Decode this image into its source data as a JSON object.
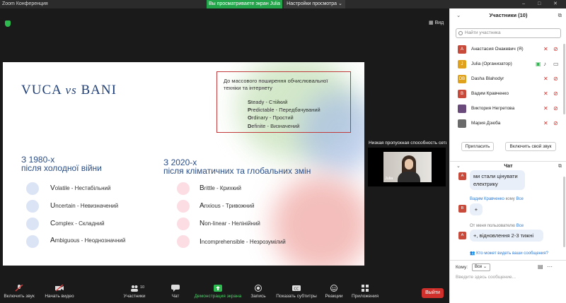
{
  "window": {
    "title": "Zoom Конференция",
    "controls": "–  □  ✕"
  },
  "share_banner": "Вы просматриваете экран Julia",
  "view_options": "Настройки просмотра ⌄",
  "stage": {
    "view_label": "Вид"
  },
  "slide": {
    "title_left": "VUCA ",
    "title_vs": "vs",
    "title_right": " BANI",
    "pre_heading": "До массового поширення обчислювальної техніки та інтернету",
    "svod": [
      {
        "cap": "S",
        "rest": "teady - Стійкий"
      },
      {
        "cap": "P",
        "rest": "redictable - Передбачуваний"
      },
      {
        "cap": "O",
        "rest": "rdinary - Простий"
      },
      {
        "cap": "D",
        "rest": "efinite - Визначений"
      }
    ],
    "left_heading_1": "З 1980-х",
    "left_heading_2": "після холодної війни",
    "right_heading_1": "З 2020-х",
    "right_heading_2": "після кліматичних та глобальних змін",
    "vuca": [
      {
        "cap": "V",
        "rest": "olatile - Нестабільний"
      },
      {
        "cap": "U",
        "rest": "ncertain - Невизначений"
      },
      {
        "cap": "C",
        "rest": "omplex - Складний"
      },
      {
        "cap": "A",
        "rest": "mbiguous - Неоднозначний"
      }
    ],
    "bani": [
      {
        "cap": "B",
        "rest": "rittle - Крихкий"
      },
      {
        "cap": "A",
        "rest": "nxious - Тривожний"
      },
      {
        "cap": "N",
        "rest": "on-linear - Нелінійний"
      },
      {
        "cap": "I",
        "rest": "ncomprehensible - Незрозумілий"
      }
    ]
  },
  "self_video": {
    "bandwidth_text": "Низкая пропускная способность сети",
    "name": "Julia"
  },
  "toolbar": {
    "audio": "Включить звук",
    "video": "Начать видео",
    "participants": "Участники",
    "participants_count": "10",
    "chat": "Чат",
    "share": "Демонстрация экрана",
    "record": "Запись",
    "captions": "Показать субтитры",
    "reactions": "Реакции",
    "apps": "Приложения",
    "leave": "Выйти"
  },
  "participants_panel": {
    "title": "Участники (10)",
    "search_placeholder": "Найти участника",
    "participants": [
      {
        "initials": "А",
        "name": "Анастасия Онакевич (Я)",
        "color": "#c84a3a"
      },
      {
        "initials": "J",
        "name": "Julia (Организатор)",
        "color": "#e0a21c"
      },
      {
        "initials": "DB",
        "name": "Dasha Blahodyr",
        "color": "#e0a21c"
      },
      {
        "initials": "В",
        "name": "Вадим Кравченко",
        "color": "#c84a3a"
      },
      {
        "initials": "",
        "name": "Виктория Негретова",
        "color": "#6a4a7a"
      },
      {
        "initials": "",
        "name": "Мария Дзюба",
        "color": "#6a6a6a"
      }
    ],
    "invite": "Пригласить",
    "unmute": "Включить свой звук"
  },
  "chat": {
    "title": "Чат",
    "messages": [
      {
        "avatar": "А",
        "text": "ми стали цінувати електрику"
      },
      {
        "from": "Вадим Кравченко",
        "to_word": "кому",
        "to": "Все",
        "avatar": "В",
        "text": "+"
      },
      {
        "from": "От меня",
        "to_word": "пользователю",
        "to": "Все",
        "avatar": "А",
        "text": "+, відновлення 2-3 тижні"
      }
    ],
    "who_sees": "Кто может видеть ваши сообщения?",
    "to_label": "Кому:",
    "to_value": "Все",
    "input_placeholder": "Введите здесь сообщение..."
  }
}
